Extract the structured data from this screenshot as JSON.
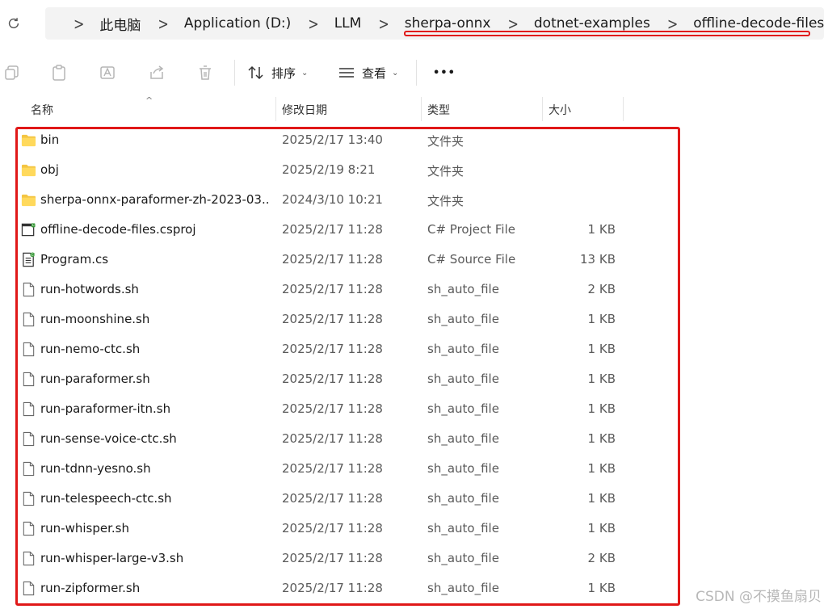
{
  "breadcrumb": [
    "此电脑",
    "Application (D:)",
    "LLM",
    "sherpa-onnx",
    "dotnet-examples",
    "offline-decode-files"
  ],
  "toolbar": {
    "sort_label": "排序",
    "view_label": "查看",
    "more_label": "•••"
  },
  "columns": {
    "name": "名称",
    "date": "修改日期",
    "type": "类型",
    "size": "大小"
  },
  "files": [
    {
      "name": "bin",
      "date": "2025/2/17 13:40",
      "type": "文件夹",
      "size": "",
      "icon": "folder-icon"
    },
    {
      "name": "obj",
      "date": "2025/2/19 8:21",
      "type": "文件夹",
      "size": "",
      "icon": "folder-icon"
    },
    {
      "name": "sherpa-onnx-paraformer-zh-2023-03...",
      "date": "2024/3/10 10:21",
      "type": "文件夹",
      "size": "",
      "icon": "folder-icon"
    },
    {
      "name": "offline-decode-files.csproj",
      "date": "2025/2/17 11:28",
      "type": "C# Project File",
      "size": "1 KB",
      "icon": "csproj-file-icon"
    },
    {
      "name": "Program.cs",
      "date": "2025/2/17 11:28",
      "type": "C# Source File",
      "size": "13 KB",
      "icon": "cs-file-icon"
    },
    {
      "name": "run-hotwords.sh",
      "date": "2025/2/17 11:28",
      "type": "sh_auto_file",
      "size": "2 KB",
      "icon": "file-icon"
    },
    {
      "name": "run-moonshine.sh",
      "date": "2025/2/17 11:28",
      "type": "sh_auto_file",
      "size": "1 KB",
      "icon": "file-icon"
    },
    {
      "name": "run-nemo-ctc.sh",
      "date": "2025/2/17 11:28",
      "type": "sh_auto_file",
      "size": "1 KB",
      "icon": "file-icon"
    },
    {
      "name": "run-paraformer.sh",
      "date": "2025/2/17 11:28",
      "type": "sh_auto_file",
      "size": "1 KB",
      "icon": "file-icon"
    },
    {
      "name": "run-paraformer-itn.sh",
      "date": "2025/2/17 11:28",
      "type": "sh_auto_file",
      "size": "1 KB",
      "icon": "file-icon"
    },
    {
      "name": "run-sense-voice-ctc.sh",
      "date": "2025/2/17 11:28",
      "type": "sh_auto_file",
      "size": "1 KB",
      "icon": "file-icon"
    },
    {
      "name": "run-tdnn-yesno.sh",
      "date": "2025/2/17 11:28",
      "type": "sh_auto_file",
      "size": "1 KB",
      "icon": "file-icon"
    },
    {
      "name": "run-telespeech-ctc.sh",
      "date": "2025/2/17 11:28",
      "type": "sh_auto_file",
      "size": "1 KB",
      "icon": "file-icon"
    },
    {
      "name": "run-whisper.sh",
      "date": "2025/2/17 11:28",
      "type": "sh_auto_file",
      "size": "1 KB",
      "icon": "file-icon"
    },
    {
      "name": "run-whisper-large-v3.sh",
      "date": "2025/2/17 11:28",
      "type": "sh_auto_file",
      "size": "2 KB",
      "icon": "file-icon"
    },
    {
      "name": "run-zipformer.sh",
      "date": "2025/2/17 11:28",
      "type": "sh_auto_file",
      "size": "1 KB",
      "icon": "file-icon"
    }
  ],
  "watermark": "CSDN @不摸鱼扇贝",
  "colors": {
    "highlight": "#e01818",
    "folder": "#f4c542"
  }
}
